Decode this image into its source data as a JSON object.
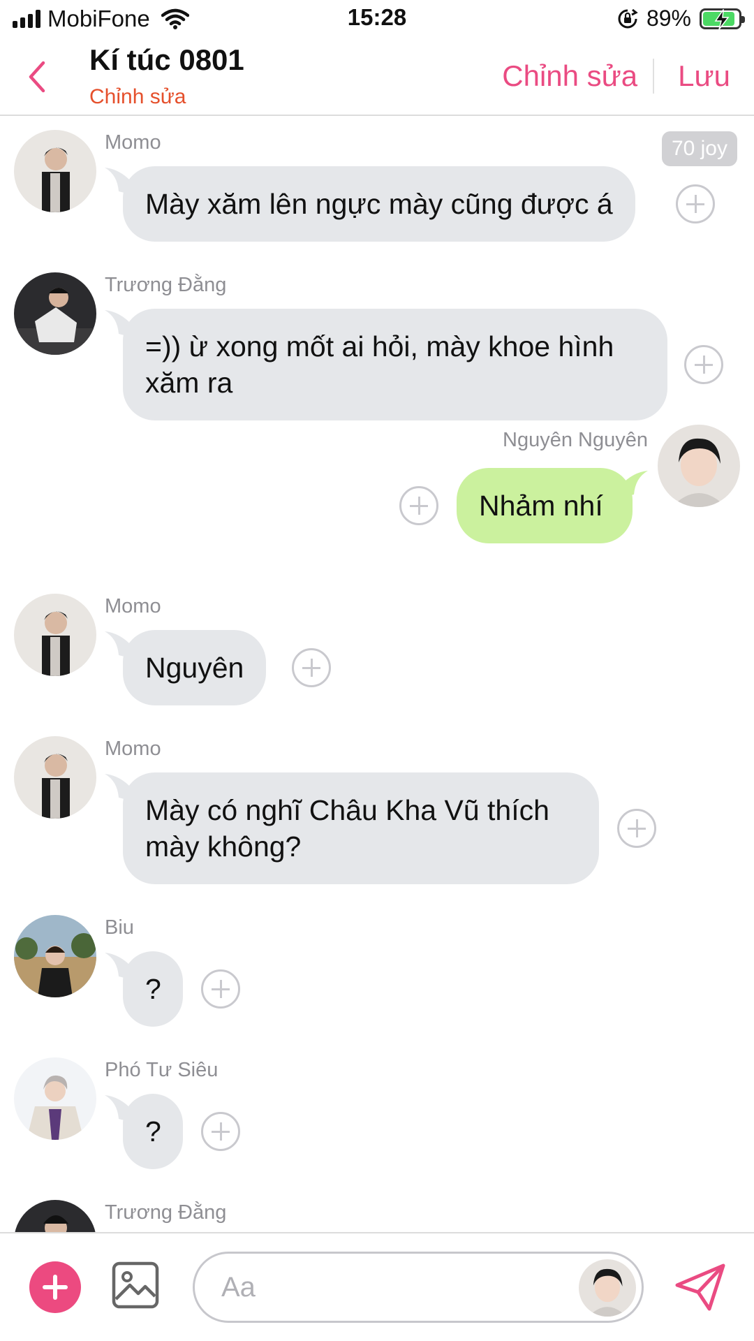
{
  "status_bar": {
    "carrier": "MobiFone",
    "time": "15:28",
    "battery_percent": "89%",
    "battery_level": 0.89
  },
  "header": {
    "title": "Kí túc 0801",
    "subtitle": "Chỉnh sửa",
    "edit_label": "Chỉnh sửa",
    "save_label": "Lưu"
  },
  "messages": [
    {
      "sender": "Momo",
      "text": "Mày xăm lên ngực mày cũng được á",
      "badge": "70 joy"
    },
    {
      "sender": "Trương Đằng",
      "text": "=)) ừ xong mốt ai hỏi, mày khoe hình xăm ra"
    },
    {
      "sender": "Nguyên Nguyên",
      "text": "Nhảm nhí",
      "mine": true
    },
    {
      "sender": "Momo",
      "text": "Nguyên"
    },
    {
      "sender": "Momo",
      "text": "Mày có nghĩ Châu Kha Vũ thích mày không?"
    },
    {
      "sender": "Biu",
      "text": "?"
    },
    {
      "sender": "Phó Tư Siêu",
      "text": "?"
    },
    {
      "sender": "Trương Đằng",
      "text": ""
    }
  ],
  "composer": {
    "placeholder": "Aa"
  },
  "colors": {
    "accent": "#ea4b82",
    "subtitle": "#e5502c",
    "bubble_other": "#e5e7ea",
    "bubble_mine": "#cbf19e",
    "battery_fill": "#4cd964"
  },
  "icons": [
    "signal-icon",
    "wifi-icon",
    "rotation-lock-icon",
    "battery-icon",
    "back-chevron-icon",
    "add-reaction-icon",
    "plus-icon",
    "image-icon",
    "send-icon"
  ]
}
